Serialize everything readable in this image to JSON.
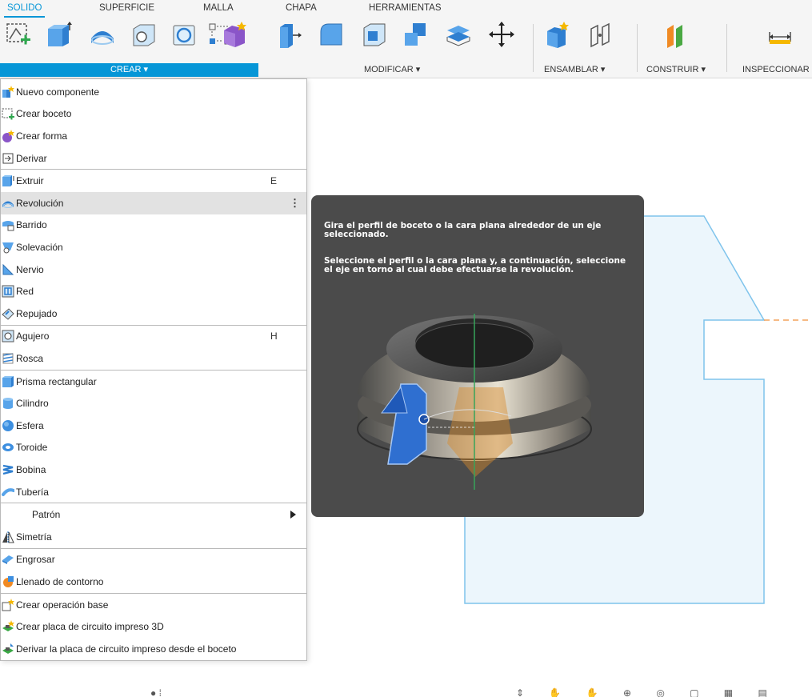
{
  "tabs": [
    "SOLIDO",
    "SUPERFICIE",
    "MALLA",
    "CHAPA",
    "HERRAMIENTAS"
  ],
  "groups": {
    "crear": "CREAR ▾",
    "modificar": "MODIFICAR ▾",
    "ensamblar": "ENSAMBLAR ▾",
    "construir": "CONSTRUIR ▾",
    "inspeccionar": "INSPECCIONAR"
  },
  "menu": {
    "items": [
      {
        "label": "Nuevo componente",
        "shortcut": ""
      },
      {
        "label": "Crear boceto",
        "shortcut": ""
      },
      {
        "label": "Crear forma",
        "shortcut": ""
      },
      {
        "label": "Derivar",
        "shortcut": ""
      },
      {
        "label": "Extruir",
        "shortcut": "E"
      },
      {
        "label": "Revolución",
        "shortcut": ""
      },
      {
        "label": "Barrido",
        "shortcut": ""
      },
      {
        "label": "Solevación",
        "shortcut": ""
      },
      {
        "label": "Nervio",
        "shortcut": ""
      },
      {
        "label": "Red",
        "shortcut": ""
      },
      {
        "label": "Repujado",
        "shortcut": ""
      },
      {
        "label": "Agujero",
        "shortcut": "H"
      },
      {
        "label": "Rosca",
        "shortcut": ""
      },
      {
        "label": "Prisma rectangular",
        "shortcut": ""
      },
      {
        "label": "Cilindro",
        "shortcut": ""
      },
      {
        "label": "Esfera",
        "shortcut": ""
      },
      {
        "label": "Toroide",
        "shortcut": ""
      },
      {
        "label": "Bobina",
        "shortcut": ""
      },
      {
        "label": "Tubería",
        "shortcut": ""
      },
      {
        "label": "Patrón",
        "shortcut": ""
      },
      {
        "label": "Simetría",
        "shortcut": ""
      },
      {
        "label": "Engrosar",
        "shortcut": ""
      },
      {
        "label": "Llenado de contorno",
        "shortcut": ""
      },
      {
        "label": "Crear operación base",
        "shortcut": ""
      },
      {
        "label": "Crear placa de circuito impreso 3D",
        "shortcut": ""
      },
      {
        "label": "Derivar la placa de circuito impreso desde el boceto",
        "shortcut": ""
      }
    ],
    "highlighted_more": "⋮"
  },
  "tooltip": {
    "line1": "Gira el perfil de boceto o la cara plana alrededor de un eje seleccionado.",
    "line2": "Seleccione el perfil o la cara plana y, a continuación, seleccione el eje en torno al cual debe efectuarse la revolución."
  },
  "colors": {
    "accent": "#0696d7",
    "sketch_fill": "#ecf6fc",
    "sketch_stroke": "#7fc4ec",
    "axis_dash": "#f0913a",
    "tooltip_bg": "#4b4b4b"
  }
}
